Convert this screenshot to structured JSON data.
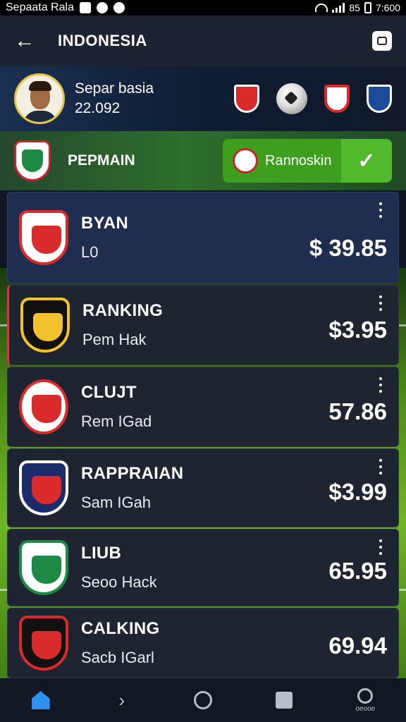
{
  "status_bar": {
    "carrier": "Sepaata Rala",
    "signal_text": "85",
    "time": "7:600"
  },
  "app_bar": {
    "title": "INDONESIA"
  },
  "profile": {
    "name": "Separ basia",
    "subtitle": "22.092"
  },
  "team_bar": {
    "label": "PEPMAIN",
    "cta_label": "Rannoskin"
  },
  "list": [
    {
      "title": "BYAN",
      "subtitle": "L0",
      "price": "$ 39.85",
      "crest_primary": "#d92b2b",
      "crest_secondary": "#ffffff"
    },
    {
      "title": "RANKING",
      "subtitle": "Pem Hak",
      "price": "$3.95",
      "crest_primary": "#111111",
      "crest_secondary": "#f2c12e"
    },
    {
      "title": "CLUJT",
      "subtitle": "Rem IGad",
      "price": "57.86",
      "crest_primary": "#d92b2b",
      "crest_secondary": "#ffffff"
    },
    {
      "title": "RAPPRAIAN",
      "subtitle": "Sam IGah",
      "price": "$3.99",
      "crest_primary": "#1b2c6b",
      "crest_secondary": "#d92b2b"
    },
    {
      "title": "LIUB",
      "subtitle": "Seoo Hack",
      "price": "65.95",
      "crest_primary": "#1f8a45",
      "crest_secondary": "#ffffff"
    },
    {
      "title": "CALKING",
      "subtitle": "Sacb IGarl",
      "price": "69.94",
      "crest_primary": "#d92b2b",
      "crest_secondary": "#111111"
    }
  ],
  "bottom_nav": {
    "user_label": "oeooe"
  },
  "colors": {
    "accent_green": "#3e9f1f",
    "nav_active": "#2d8ff0",
    "card_bg": "#1e2530"
  },
  "icons": {
    "back": "arrow-left",
    "action_1": "camera",
    "action_2": "profile",
    "check": "check",
    "nav": [
      "home",
      "arrow",
      "circle",
      "square",
      "user"
    ]
  }
}
